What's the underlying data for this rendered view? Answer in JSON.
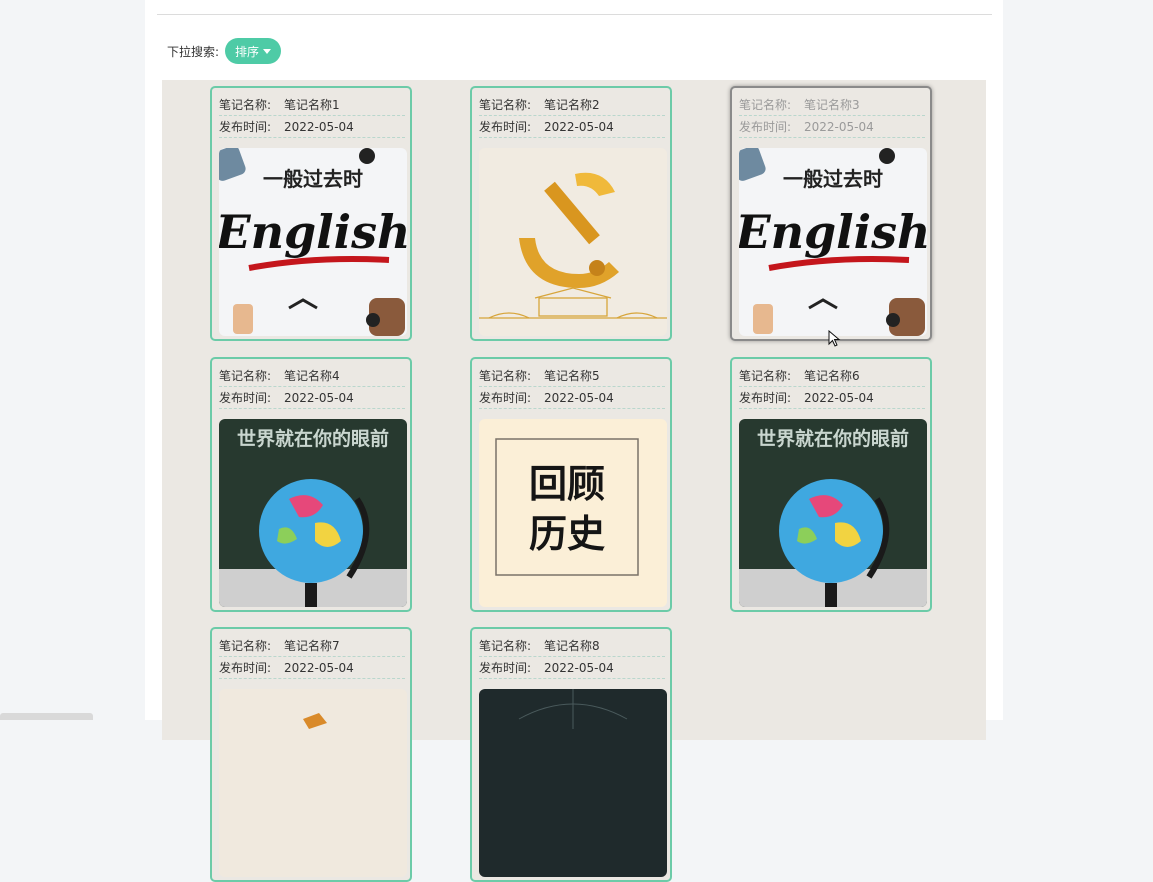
{
  "search": {
    "label": "下拉搜索:",
    "sort_button": "排序"
  },
  "notes": [
    {
      "name_label": "笔记名称:",
      "name": "笔记名称1",
      "date_label": "发布时间:",
      "date": "2022-05-04",
      "image": "english-poster",
      "poster_title": "一般过去时",
      "poster_word": "English"
    },
    {
      "name_label": "笔记名称:",
      "name": "笔记名称2",
      "date_label": "发布时间:",
      "date": "2022-05-04",
      "image": "party-emblem-poster"
    },
    {
      "name_label": "笔记名称:",
      "name": "笔记名称3",
      "date_label": "发布时间:",
      "date": "2022-05-04",
      "image": "english-poster",
      "poster_title": "一般过去时",
      "poster_word": "English"
    },
    {
      "name_label": "笔记名称:",
      "name": "笔记名称4",
      "date_label": "发布时间:",
      "date": "2022-05-04",
      "image": "globe-poster",
      "poster_title": "世界就在你的眼前"
    },
    {
      "name_label": "笔记名称:",
      "name": "笔记名称5",
      "date_label": "发布时间:",
      "date": "2022-05-04",
      "image": "history-poster",
      "poster_line1": "回顾",
      "poster_line2": "历史"
    },
    {
      "name_label": "笔记名称:",
      "name": "笔记名称6",
      "date_label": "发布时间:",
      "date": "2022-05-04",
      "image": "globe-poster",
      "poster_title": "世界就在你的眼前"
    },
    {
      "name_label": "笔记名称:",
      "name": "笔记名称7",
      "date_label": "发布时间:",
      "date": "2022-05-04",
      "image": "orange-poster"
    },
    {
      "name_label": "笔记名称:",
      "name": "笔记名称8",
      "date_label": "发布时间:",
      "date": "2022-05-04",
      "image": "dark-poster"
    }
  ],
  "colors": {
    "accent": "#4ecba6",
    "card_border": "#6ccba8",
    "grid_bg": "#ebe8e3"
  }
}
